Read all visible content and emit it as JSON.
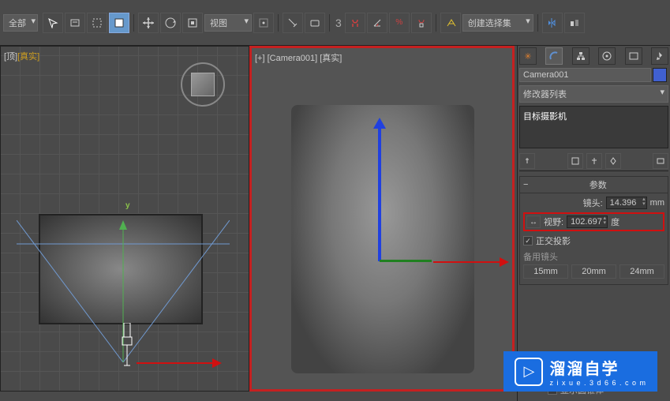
{
  "toolbar": {
    "selection_set_label": "全部",
    "viewport_label": "视图",
    "numeric": "3",
    "named_selection": "创建选择集"
  },
  "viewports": {
    "top": {
      "label_prefix": "[顶]",
      "label_mode": "[真实]",
      "axis_y": "y"
    },
    "camera": {
      "label": "[+] [Camera001] [真实]"
    }
  },
  "panel": {
    "object_name": "Camera001",
    "modifier_dropdown": "修改器列表",
    "stack_item": "目标摄影机",
    "rollout_title": "参数",
    "lens_label": "镜头:",
    "lens_value": "14.396",
    "lens_unit": "mm",
    "fov_label": "视野:",
    "fov_value": "102.697",
    "fov_unit": "度",
    "ortho_label": "正交投影",
    "stock_lenses_label": "备用镜头",
    "lenses_row1": [
      "15mm",
      "20mm",
      "24mm"
    ],
    "show_cone": "显示圆锥体"
  },
  "watermark": {
    "cn": "溜溜自学",
    "en": "z i x u e . 3 d 6 6 . c o m"
  }
}
